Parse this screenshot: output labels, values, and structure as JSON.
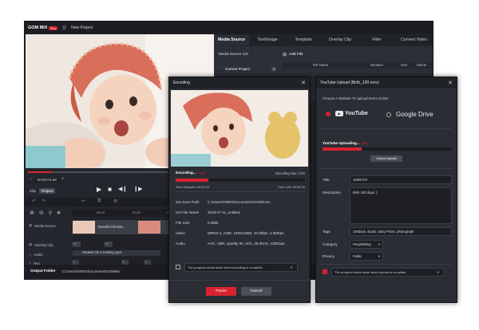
{
  "main": {
    "app_logo": "GOM MIX",
    "app_badge": "Pro",
    "window_title": "New Project",
    "playback": {
      "timecode": "00:00:01.68",
      "clip_label": "Clip",
      "project_label": "Project"
    },
    "tabs": [
      "Media Source",
      "Text/Image",
      "Template",
      "Overlay Clip",
      "Filter",
      "Convert Video"
    ],
    "media_panel": {
      "source_list_label": "Media Source List",
      "current_project_label": "Current Project",
      "current_project_count": "8",
      "add_file_label": "Add File",
      "columns": [
        "File Name",
        "Duration",
        "Size",
        "Delete"
      ]
    },
    "timeline": {
      "ruler": [
        "00:15",
        "00:20",
        "00:25"
      ],
      "tracks": [
        "Media Source",
        "Overlay Clip",
        "Audio",
        "Text",
        "Image"
      ],
      "clip_label": "Beautiful blonde...",
      "audio_clip": "Hooked On A Feeling.mp3",
      "small_clip_labels": [
        "CO",
        "CO",
        "C",
        "E",
        "C"
      ]
    },
    "output": {
      "label": "Output Folder",
      "path": "C:\\Users\\GRES\\Documents\\GOMMix"
    }
  },
  "encoding": {
    "title": "Encoding",
    "status": "Encoding...",
    "percent": "10%",
    "progress": 0.25,
    "rate_label": "Encoding rate: 3.0X",
    "time_elapsed": "Time Elapsed: 00:00:10",
    "time_left": "Time Left: 00:00:30",
    "fields": [
      {
        "label": "Set Save Path",
        "value": "C:\\Users\\GRES\\Documents\\GOMCam"
      },
      {
        "label": "Set File Name",
        "value": "2018-07-11_untitled"
      },
      {
        "label": "File Size",
        "value": "0.0MB"
      },
      {
        "label": "Video",
        "value": "MPEG-4, CBR, 1920x1080, 15.00fps, 4.9Mbps"
      },
      {
        "label": "Audio",
        "value": "AAC, VBR, Quality 90, 2Ch, 48.0KHz, 128Kbps"
      }
    ],
    "shutdown_text": "The program shuts down when encoding is complete.",
    "pause_label": "Pause",
    "cancel_label": "Cancel"
  },
  "youtube": {
    "title": "YouTube Upload (Birth_100.mov)",
    "choose_label": "Choose A Website To Upload Items Online",
    "services": [
      "YouTube",
      "Google Drive"
    ],
    "uploading_label": "YouTube Uploading...",
    "uploading_percent": "30%",
    "progress": 0.3,
    "cancel_upload": "Cancel upload",
    "fields": {
      "title_label": "Title",
      "title_value": "100DAYS",
      "description_label": "Description",
      "description_value": "Birth 100 days :)",
      "tags_label": "Tags",
      "tags_value": "100days, studio, baby Photo, photograph",
      "category_label": "Category",
      "category_value": "People/Blog",
      "privacy_label": "Privacy",
      "privacy_value": "Public"
    },
    "shutdown_text": "The program shuts down when upload is complete."
  },
  "colors": {
    "accent_red": "#d9232f",
    "dialog_bg": "#2a2d34",
    "window_bg": "#23262d"
  }
}
